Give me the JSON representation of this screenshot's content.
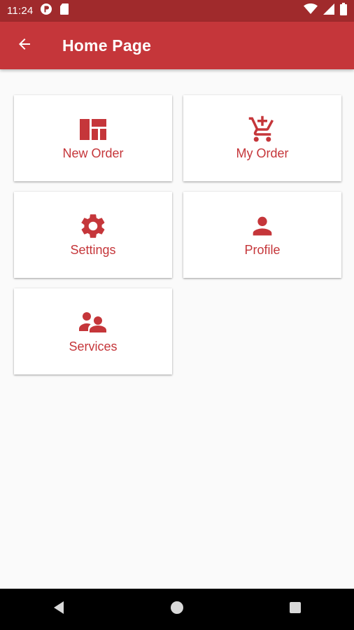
{
  "status_bar": {
    "time": "11:24"
  },
  "app_bar": {
    "title": "Home Page"
  },
  "colors": {
    "primary": "#c5363a",
    "status": "#a02a2c",
    "background": "#fafafa"
  },
  "tiles": [
    {
      "label": "New Order",
      "icon": "dashboard-icon"
    },
    {
      "label": "My Order",
      "icon": "add-shopping-cart-icon"
    },
    {
      "label": "Settings",
      "icon": "gear-icon"
    },
    {
      "label": "Profile",
      "icon": "person-icon"
    },
    {
      "label": "Services",
      "icon": "people-icon"
    }
  ],
  "nav": {
    "back": "back-triangle-icon",
    "home": "home-circle-icon",
    "recents": "recents-square-icon"
  }
}
